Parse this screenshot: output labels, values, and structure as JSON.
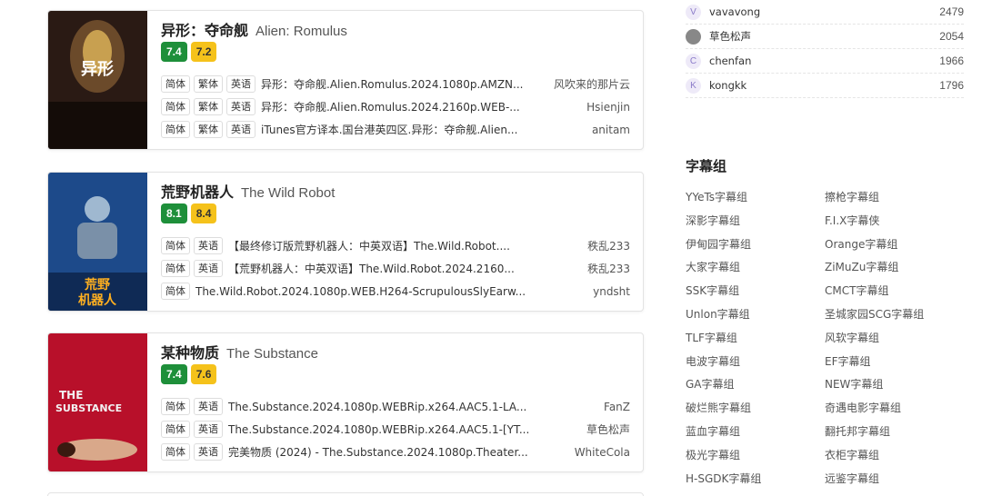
{
  "movies": [
    {
      "title_cn": "异形：夺命舰",
      "title_en": "Alien: Romulus",
      "ratings": [
        "7.4",
        "7.2"
      ],
      "poster": {
        "text": "异形",
        "bg": "#2a1a14",
        "accent": "#c8a050"
      },
      "subs": [
        {
          "tags": [
            "简体",
            "繁体",
            "英语"
          ],
          "name": "异形：夺命舰.Alien.Romulus.2024.1080p.AMZN...",
          "uploader": "风吹来的那片云"
        },
        {
          "tags": [
            "简体",
            "繁体",
            "英语"
          ],
          "name": "异形：夺命舰.Alien.Romulus.2024.2160p.WEB-...",
          "uploader": "Hsienjin"
        },
        {
          "tags": [
            "简体",
            "繁体",
            "英语"
          ],
          "name": "iTunes官方译本.国台港英四区.异形：夺命舰.Alien...",
          "uploader": "anitam"
        }
      ]
    },
    {
      "title_cn": "荒野机器人",
      "title_en": "The Wild Robot",
      "ratings": [
        "8.1",
        "8.4"
      ],
      "poster": {
        "text": "荒野机器人",
        "bg": "#1d4a8a",
        "accent": "#ffb020"
      },
      "subs": [
        {
          "tags": [
            "简体",
            "英语"
          ],
          "name": "【最终修订版荒野机器人：中英双语】The.Wild.Robot....",
          "uploader": "秩乱233"
        },
        {
          "tags": [
            "简体",
            "英语"
          ],
          "name": "【荒野机器人：中英双语】The.Wild.Robot.2024.2160...",
          "uploader": "秩乱233"
        },
        {
          "tags": [
            "简体"
          ],
          "name": "The.Wild.Robot.2024.1080p.WEB.H264-ScrupulousSlyEarw...",
          "uploader": "yndsht"
        }
      ]
    },
    {
      "title_cn": "某种物质",
      "title_en": "The Substance",
      "ratings": [
        "7.4",
        "7.6"
      ],
      "poster": {
        "text": "THE SUBSTANCE",
        "bg": "#b8102a",
        "accent": "#f2f2f2"
      },
      "subs": [
        {
          "tags": [
            "简体",
            "英语"
          ],
          "name": "The.Substance.2024.1080p.WEBRip.x264.AAC5.1-LA...",
          "uploader": "FanZ"
        },
        {
          "tags": [
            "简体",
            "英语"
          ],
          "name": "The.Substance.2024.1080p.WEBRip.x264.AAC5.1-[YT...",
          "uploader": "草色松声"
        },
        {
          "tags": [
            "简体",
            "英语"
          ],
          "name": "完美物质 (2024) - The.Substance.2024.1080p.Theater...",
          "uploader": "WhiteCola"
        }
      ]
    }
  ],
  "rank": [
    {
      "initial": "V",
      "name": "vavavong",
      "count": "2479"
    },
    {
      "initial": "",
      "name": "草色松声",
      "count": "2054"
    },
    {
      "initial": "C",
      "name": "chenfan",
      "count": "1966"
    },
    {
      "initial": "K",
      "name": "kongkk",
      "count": "1796"
    }
  ],
  "groups_title": "字幕组",
  "groups": [
    "YYeTs字幕组",
    "擦枪字幕组",
    "深影字幕组",
    "F.I.X字幕侠",
    "伊甸园字幕组",
    "Orange字幕组",
    "大家字幕组",
    "ZiMuZu字幕组",
    "SSK字幕组",
    "CMCT字幕组",
    "Unlon字幕组",
    "圣城家园SCG字幕组",
    "TLF字幕组",
    "风软字幕组",
    "电波字幕组",
    "EF字幕组",
    "GA字幕组",
    "NEW字幕组",
    "破烂熊字幕组",
    "奇遇电影字幕组",
    "蓝血字幕组",
    "翻托邦字幕组",
    "极光字幕组",
    "衣柜字幕组",
    "H-SGDK字幕组",
    "远鉴字幕组"
  ]
}
